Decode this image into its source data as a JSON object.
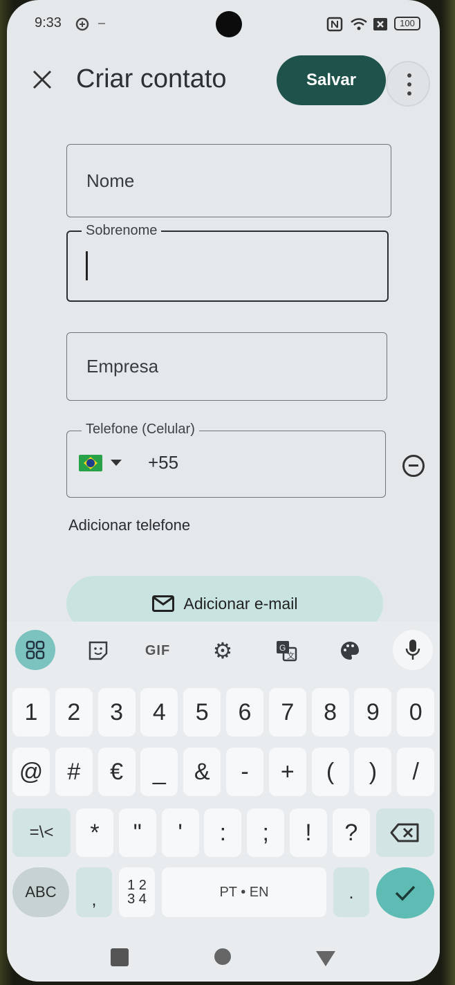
{
  "status_bar": {
    "time": "9:33",
    "battery": "100"
  },
  "app_bar": {
    "title": "Criar contato",
    "save_label": "Salvar"
  },
  "form": {
    "nome_placeholder": "Nome",
    "sobrenome_label": "Sobrenome",
    "empresa_placeholder": "Empresa",
    "telefone_label": "Telefone (Celular)",
    "country_code": "+55",
    "add_phone_label": "Adicionar telefone",
    "add_email_label": "Adicionar e-mail"
  },
  "keyboard": {
    "toolbar": {
      "gif_label": "GIF"
    },
    "row1": [
      "1",
      "2",
      "3",
      "4",
      "5",
      "6",
      "7",
      "8",
      "9",
      "0"
    ],
    "row2": [
      "@",
      "#",
      "€",
      "_",
      "&",
      "-",
      "+",
      "(",
      ")",
      "/"
    ],
    "row3": [
      "=\\<",
      "*",
      "\"",
      "'",
      ":",
      ";",
      "!",
      "?"
    ],
    "abc_label": "ABC",
    "comma": ",",
    "numpad_top": "1 2",
    "numpad_bottom": "3 4",
    "space_label": "PT • EN",
    "period": "."
  },
  "colors": {
    "save_button": "#1f524b",
    "email_button": "#c8e3e0",
    "accent_key": "#5fbcb5"
  }
}
